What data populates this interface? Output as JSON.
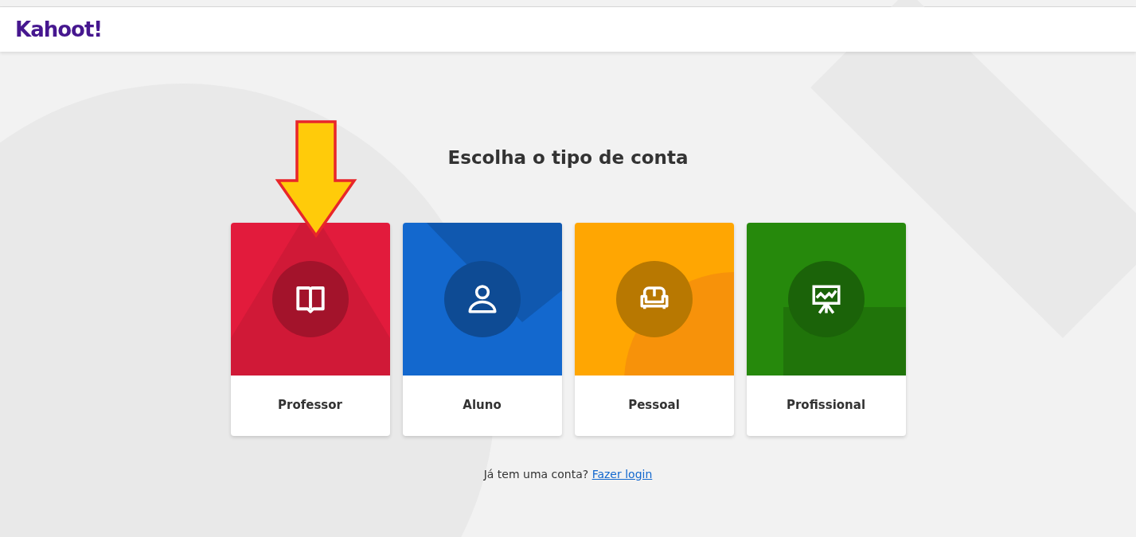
{
  "header": {
    "logo": "Kahoot!"
  },
  "title": "Escolha o tipo de conta",
  "cards": [
    {
      "kind": "teacher",
      "label": "Professor",
      "color": "#e21b3c"
    },
    {
      "kind": "student",
      "label": "Aluno",
      "color": "#1368ce"
    },
    {
      "kind": "personal",
      "label": "Pessoal",
      "color": "#ffa602"
    },
    {
      "kind": "professional",
      "label": "Profissional",
      "color": "#26890c"
    }
  ],
  "login": {
    "text": "Já tem uma conta?",
    "link": "Fazer login"
  },
  "annotation": {
    "kind": "arrow"
  }
}
